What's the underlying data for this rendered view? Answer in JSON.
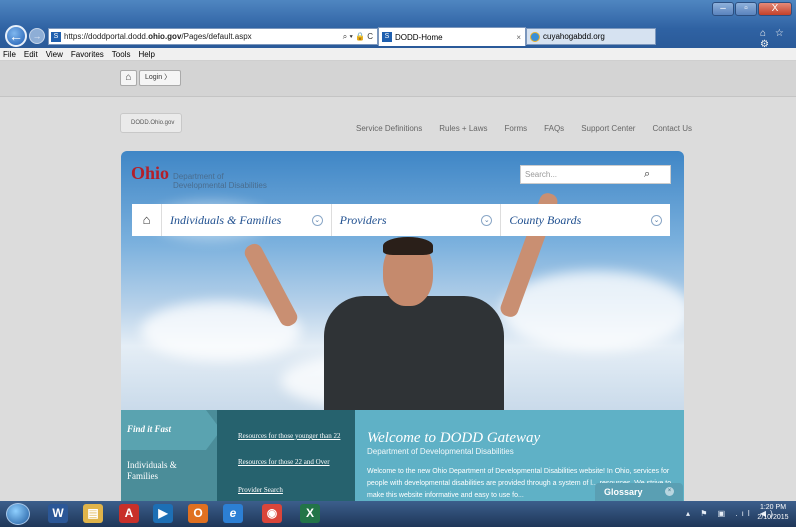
{
  "browser": {
    "url_prefix": "https://doddportal.dodd.",
    "url_domain": "ohio.gov",
    "url_suffix": "/Pages/default.aspx",
    "addr_tools": "⌕ ▾ 🔒 C",
    "active_tab": "DODD-Home",
    "second_tab": "cuyahogabdd.org",
    "tab_close": "×",
    "right_icons": "⌂ ☆ ⚙",
    "window_buttons": [
      "–",
      "▫",
      "X"
    ],
    "menu": [
      "File",
      "Edit",
      "View",
      "Favorites",
      "Tools",
      "Help"
    ]
  },
  "toolbar": {
    "home": "⌂",
    "login": "Login  〉"
  },
  "site": {
    "dodd_tab": "DODD.Ohio.gov",
    "top_links": [
      "Service Definitions",
      "Rules + Laws",
      "Forms",
      "FAQs",
      "Support Center",
      "Contact Us"
    ],
    "logo_ohio": "Ohio",
    "logo_dept_1": "Department of",
    "logo_dept_2": "Developmental Disabilities",
    "search_placeholder": "Search...",
    "search_icon": "⌕",
    "nav_home": "⌂",
    "nav": [
      "Individuals & Families",
      "Providers",
      "County Boards"
    ],
    "nav_chevron": "⌄"
  },
  "findfast": {
    "title": "Find it Fast",
    "individuals": "Individuals & Families",
    "links": [
      "Resources for those younger than 22",
      "Resources for those 22 and Over",
      "Provider Search"
    ]
  },
  "welcome": {
    "title": "Welcome to DODD Gateway",
    "subtitle": "Department of Developmental Disabilities",
    "body": "Welcome to the new Ohio Department of Developmental Disabilities website! In Ohio, services for people with developmental disabilities are provided through a system of l... resources. We strive to make this website informative and easy to use fo..."
  },
  "glossary": {
    "label": "Glossary",
    "close": "×"
  },
  "taskbar": {
    "apps": [
      "W",
      "▤",
      "A",
      "▶",
      "O",
      "e",
      "◉",
      "X"
    ],
    "tray": "▴ ⚑ ▣ .ıl ◀)",
    "time": "1:20 PM",
    "date": "2/10/2015"
  },
  "colors": {
    "accent": "#1f4f8f",
    "ohio_red": "#b3202a",
    "teal": "#26626e",
    "welcome_bg": "#5fb1c6"
  }
}
